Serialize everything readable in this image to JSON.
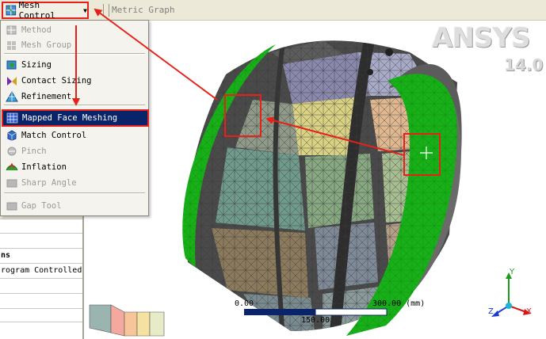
{
  "toolbar": {
    "mesh_control_label": "Mesh Control",
    "metric_graph_label": "Metric Graph"
  },
  "menu": {
    "items": [
      {
        "label": "Method",
        "icon": "method-icon",
        "enabled": false
      },
      {
        "label": "Mesh Group",
        "icon": "mesh-group-icon",
        "enabled": false
      },
      {
        "label": "Sizing",
        "icon": "sizing-icon",
        "enabled": true
      },
      {
        "label": "Contact Sizing",
        "icon": "contact-sizing-icon",
        "enabled": true
      },
      {
        "label": "Refinement",
        "icon": "refinement-icon",
        "enabled": true
      },
      {
        "label": "Mapped Face Meshing",
        "icon": "mapped-face-meshing-icon",
        "enabled": true,
        "selected": true
      },
      {
        "label": "Match Control",
        "icon": "match-control-icon",
        "enabled": true
      },
      {
        "label": "Pinch",
        "icon": "pinch-icon",
        "enabled": false
      },
      {
        "label": "Inflation",
        "icon": "inflation-icon",
        "enabled": true
      },
      {
        "label": "Sharp Angle",
        "icon": "sharp-angle-icon",
        "enabled": false
      },
      {
        "label": "Gap Tool",
        "icon": "gap-tool-icon",
        "enabled": false
      }
    ]
  },
  "details_panel": {
    "section_label": "ns",
    "value_label": "rogram Controlled"
  },
  "logo": {
    "brand": "ANSYS",
    "version": "14.0"
  },
  "scale": {
    "left": "0.00",
    "right": "300.00 (mm)",
    "mid": "150.00"
  },
  "axes": {
    "x": "X",
    "y": "Y",
    "z": "Z"
  },
  "colors": {
    "highlight_red": "#e8201a",
    "selection_blue": "#0a246a",
    "end_cap_green": "#18b018"
  }
}
